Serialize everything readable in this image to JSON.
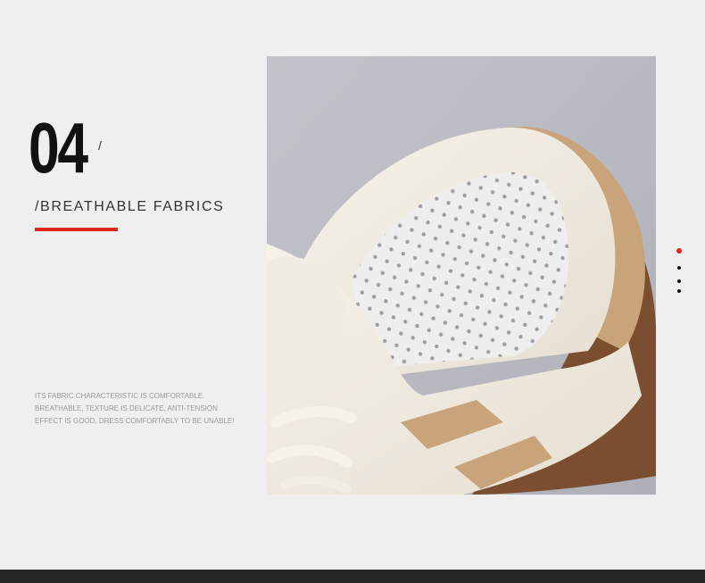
{
  "feature": {
    "number": "04",
    "slash": "/",
    "title": "/BREATHABLE FABRICS",
    "description_lines": [
      "ITS FABRIC CHARACTERISTIC IS COMFORTABLE.",
      "BREATHABLE, TEXTURE IS DELICATE, ANTI-TENSION",
      "EFFECT IS GOOD, DRESS COMFORTABLY TO BE UNABLE!"
    ]
  },
  "colors": {
    "accent": "#e0261c",
    "background": "#efefef",
    "band": "#252525"
  },
  "pagination": {
    "count": 4,
    "active_index": 0
  }
}
